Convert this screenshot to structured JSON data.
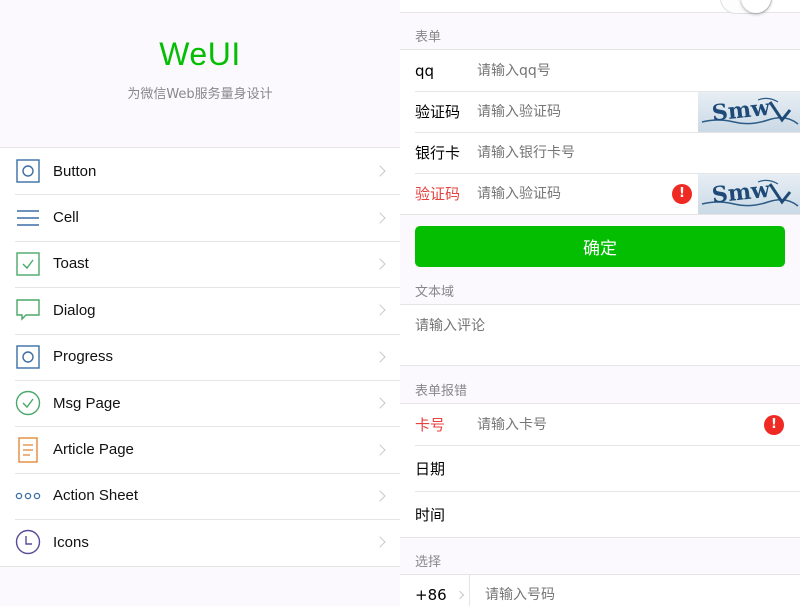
{
  "header": {
    "title": "WeUI",
    "subtitle": "为微信Web服务量身设计"
  },
  "menu": [
    {
      "label": "Button",
      "icon": "button-icon"
    },
    {
      "label": "Cell",
      "icon": "cell-icon"
    },
    {
      "label": "Toast",
      "icon": "toast-icon"
    },
    {
      "label": "Dialog",
      "icon": "dialog-icon"
    },
    {
      "label": "Progress",
      "icon": "progress-icon"
    },
    {
      "label": "Msg Page",
      "icon": "msg-page-icon"
    },
    {
      "label": "Article Page",
      "icon": "article-page-icon"
    },
    {
      "label": "Action Sheet",
      "icon": "action-sheet-icon"
    },
    {
      "label": "Icons",
      "icon": "icons-icon"
    }
  ],
  "form": {
    "section_title": "表单",
    "qq_label": "qq",
    "qq_placeholder": "请输入qq号",
    "vcode_label": "验证码",
    "vcode_placeholder": "请输入验证码",
    "bank_label": "银行卡",
    "bank_placeholder": "请输入银行卡号",
    "vcode2_label": "验证码",
    "vcode2_placeholder": "请输入验证码",
    "confirm_button": "确定"
  },
  "textarea": {
    "section_title": "文本域",
    "placeholder": "请输入评论"
  },
  "form_error": {
    "section_title": "表单报错",
    "card_label": "卡号",
    "card_placeholder": "请输入卡号",
    "date_label": "日期",
    "time_label": "时间"
  },
  "select": {
    "section_title": "选择",
    "country_code": "+86",
    "phone_placeholder": "请输入号码"
  },
  "colors": {
    "brand_green": "#04be02",
    "error_red": "#e64340",
    "icon_blue": "#3a6ea5"
  }
}
